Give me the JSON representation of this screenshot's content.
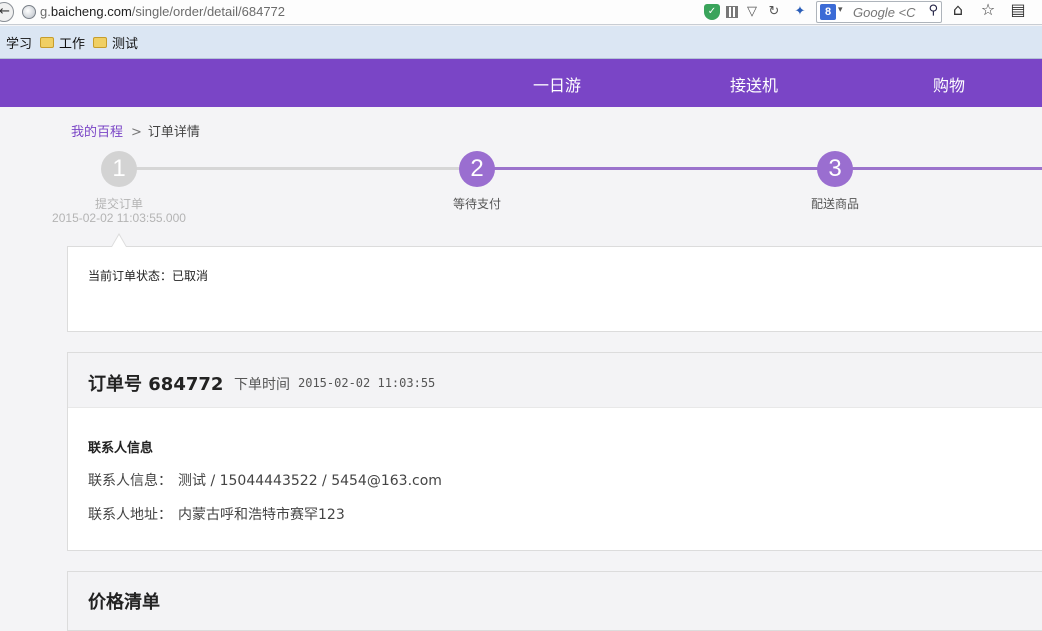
{
  "browser": {
    "url_prefix": "g.",
    "url_domain": "baicheng.com",
    "url_path": "/single/order/detail/684772",
    "search_engine_letter": "8",
    "search_placeholder": "Google <C",
    "bookmarks": [
      "学习",
      "工作",
      "测试"
    ]
  },
  "nav": {
    "items": [
      "一日游",
      "接送机",
      "购物"
    ],
    "bg_color": "#7a45c6"
  },
  "breadcrumb": {
    "home": "我的百程",
    "separator": ">",
    "current": "订单详情"
  },
  "steps": [
    {
      "number": "1",
      "label": "提交订单",
      "time": "2015-02-02 11:03:55.000",
      "state": "done"
    },
    {
      "number": "2",
      "label": "等待支付",
      "state": "active"
    },
    {
      "number": "3",
      "label": "配送商品",
      "state": "active"
    }
  ],
  "status": {
    "text": "当前订单状态：已取消"
  },
  "order": {
    "number_text": "订单号 684772",
    "time_label": "下单时间",
    "time_value": "2015-02-02 11:03:55",
    "contact_section_title": "联系人信息",
    "contact_label": "联系人信息：",
    "contact_value": "测试 / 15044443522 / 5454@163.com",
    "address_label": "联系人地址：",
    "address_value": "内蒙古呼和浩特市赛罕123"
  },
  "price": {
    "title": "价格清单"
  }
}
